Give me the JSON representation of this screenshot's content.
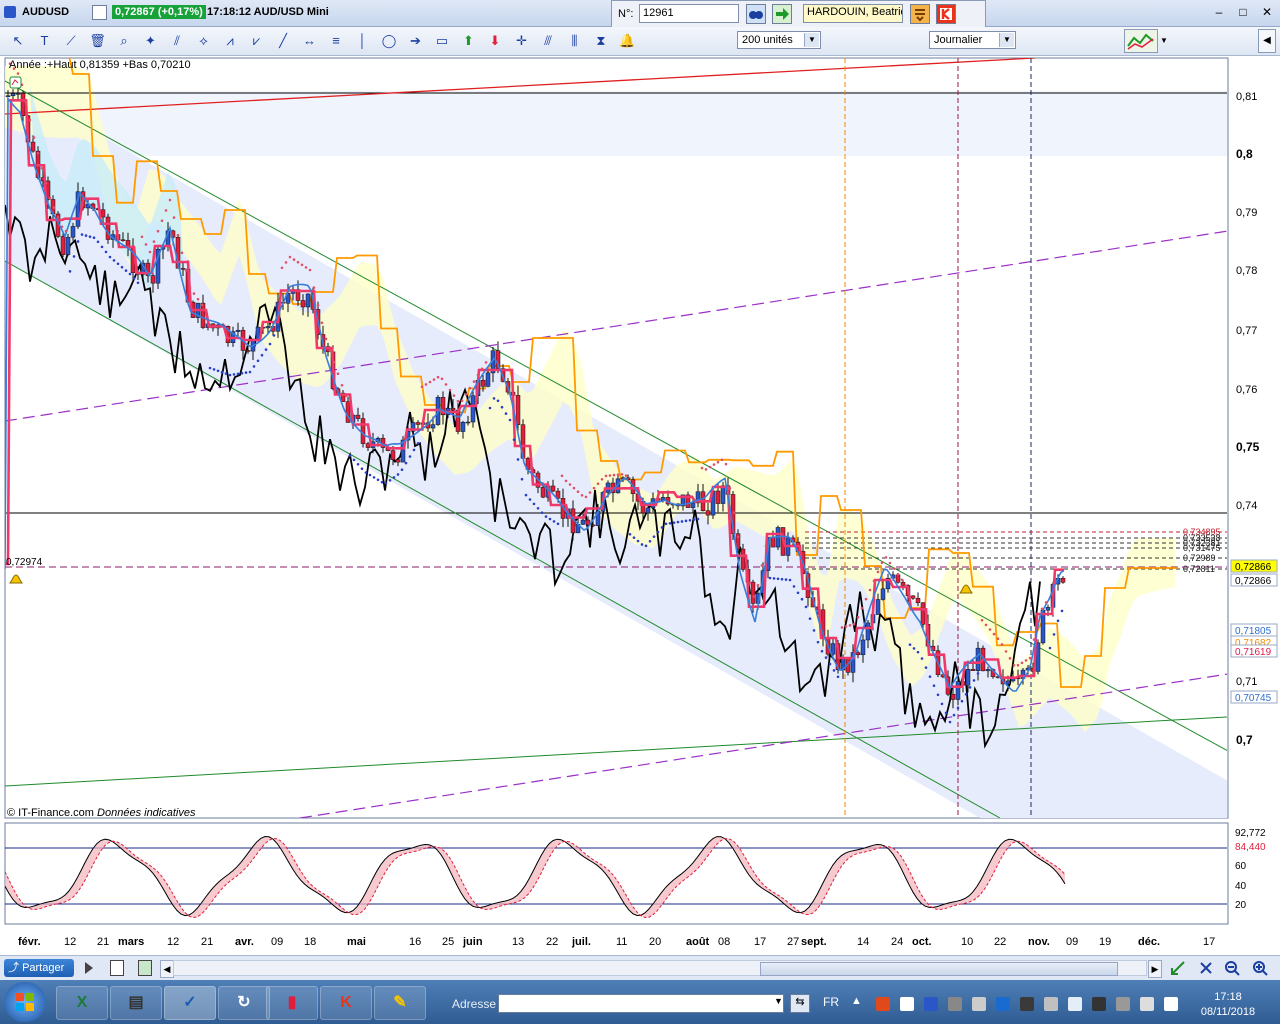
{
  "window": {
    "symbol": "AUDUSD",
    "last_price_change": "0,72867 (+0,17%)",
    "time_title": "17:18:12 AUD/USD Mini",
    "controls": [
      "–",
      "□",
      "✕"
    ]
  },
  "lookup": {
    "number_label": "N°:",
    "number_value": "12961",
    "name_value": "HARDOUIN, Beatrice"
  },
  "toolbar": {
    "units_select": "200 unités",
    "period_select": "Journalier",
    "tools": [
      "cursor-icon",
      "text-tool-icon",
      "ruler-icon",
      "trash-icon",
      "zoom-icon",
      "magic-icon",
      "fibonacci-icon",
      "fan-icon",
      "wave-a-icon",
      "wave-b-icon",
      "trendline-icon",
      "h-arrow-icon",
      "h-lines-icon",
      "v-line-icon",
      "lasso-icon",
      "arrow-icon",
      "rectangle-icon",
      "up-arrow-icon",
      "down-arrow-icon",
      "cross-arrow-icon",
      "channel-icon",
      "parallel-icon",
      "magnet-icon",
      "alarm-icon"
    ]
  },
  "chart": {
    "range_text": "Année :+Haut 0,81359 +Bas 0,70210",
    "left_value_label": "0,72974",
    "copyright": "© IT-Finance.com",
    "data_note": "Données indicatives",
    "price_axis": [
      "0,81",
      "0,8",
      "0,79",
      "0,78",
      "0,77",
      "0,76",
      "0,75",
      "0,74",
      "0,71",
      "0,7"
    ],
    "price_tags": [
      {
        "text": "0,72866",
        "color": "#ffff00",
        "fg": "#000000"
      },
      {
        "text": "0,72866",
        "color": "#ffffff",
        "fg": "#000000"
      },
      {
        "text": "0,71805",
        "color": "#ffffff",
        "fg": "#2f6ecf"
      },
      {
        "text": "0,71682",
        "color": "#ffffff",
        "fg": "#f08a00"
      },
      {
        "text": "0,71619",
        "color": "#ffffff",
        "fg": "#e0194d"
      },
      {
        "text": "0,70745",
        "color": "#ffffff",
        "fg": "#2f6ecf"
      }
    ],
    "fib_levels": [
      "0,734895",
      "0,733538",
      "0,732381",
      "0,731475",
      "0,72989",
      "0,72811"
    ],
    "oscillator_axis": [
      "92,772",
      "84,440",
      "60",
      "40",
      "20"
    ],
    "date_axis": [
      {
        "t": "févr.",
        "bold": true
      },
      {
        "t": "12"
      },
      {
        "t": "21"
      },
      {
        "t": "mars",
        "bold": true
      },
      {
        "t": "12"
      },
      {
        "t": "21"
      },
      {
        "t": "avr.",
        "bold": true
      },
      {
        "t": "09"
      },
      {
        "t": "18"
      },
      {
        "t": "mai",
        "bold": true
      },
      {
        "t": "16"
      },
      {
        "t": "25"
      },
      {
        "t": "juin",
        "bold": true
      },
      {
        "t": "13"
      },
      {
        "t": "22"
      },
      {
        "t": "juil.",
        "bold": true
      },
      {
        "t": "11"
      },
      {
        "t": "20"
      },
      {
        "t": "août",
        "bold": true
      },
      {
        "t": "08"
      },
      {
        "t": "17"
      },
      {
        "t": "27"
      },
      {
        "t": "sept.",
        "bold": true
      },
      {
        "t": "14"
      },
      {
        "t": "24"
      },
      {
        "t": "oct.",
        "bold": true
      },
      {
        "t": "10"
      },
      {
        "t": "22"
      },
      {
        "t": "nov.",
        "bold": true
      },
      {
        "t": "09"
      },
      {
        "t": "19"
      },
      {
        "t": "déc.",
        "bold": true
      },
      {
        "t": "17"
      }
    ]
  },
  "bottom": {
    "share_label": "Partager"
  },
  "taskbar": {
    "address_label": "Adresse",
    "lang": "FR",
    "clock_time": "17:18",
    "clock_date": "08/11/2018"
  },
  "colors": {
    "up_candle": "#2a56c8",
    "down_candle": "#e01f3d",
    "kijun": "#f0386b",
    "tenkan": "#3a7ddb",
    "senkou": "#ff9a00",
    "chikou": "#000000"
  }
}
